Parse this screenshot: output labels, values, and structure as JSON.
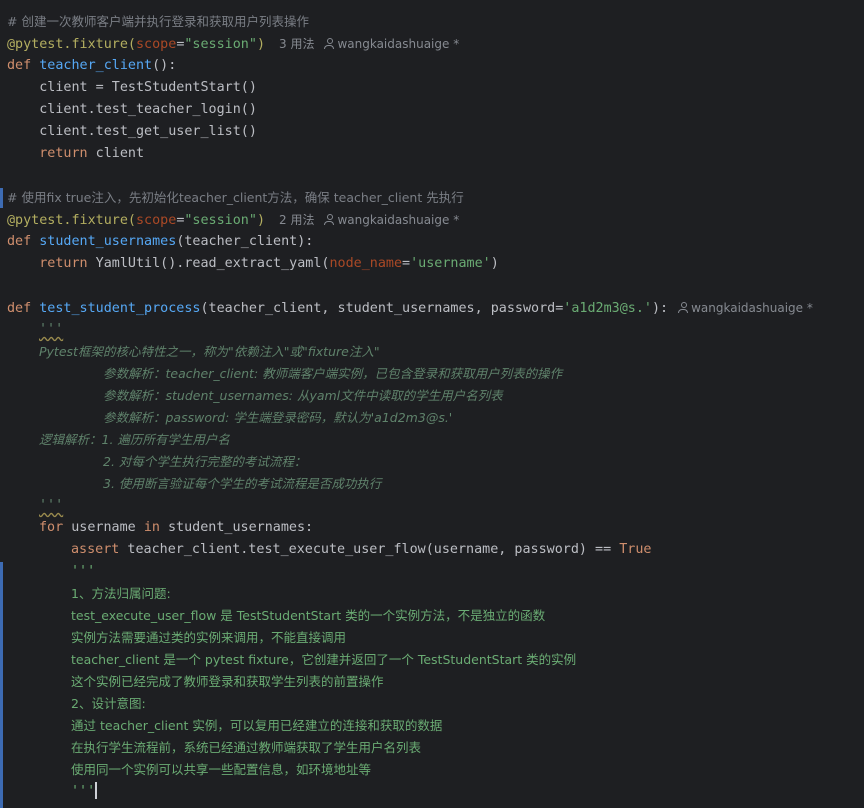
{
  "l1": "# 创建一次教师客户端并执行登录和获取用户列表操作",
  "l2": {
    "deco": "@pytest.fixture(",
    "param": "scope",
    "eq": "=",
    "str": "\"session\"",
    "close": ")",
    "usages": "3 用法",
    "author": "wangkaidashuaige *"
  },
  "l3": {
    "kw": "def ",
    "fn": "teacher_client",
    "rest": "():"
  },
  "l4": "    client = TestStudentStart()",
  "l5": "    client.test_teacher_login()",
  "l6": "    client.test_get_user_list()",
  "l7": {
    "kw": "    return",
    "rest": " client"
  },
  "l9": "# 使用fix true注入，先初始化teacher_client方法，确保 teacher_client 先执行",
  "l10": {
    "deco": "@pytest.fixture(",
    "param": "scope",
    "eq": "=",
    "str": "\"session\"",
    "close": ")",
    "usages": "2 用法",
    "author": "wangkaidashuaige *"
  },
  "l11": {
    "kw": "def ",
    "fn": "student_usernames",
    "rest": "(teacher_client):"
  },
  "l12": {
    "kw": "    return",
    "a": " YamlUtil().read_extract_yaml(",
    "param": "node_name",
    "eq": "=",
    "str": "'username'",
    "close": ")"
  },
  "l14": {
    "kw": "def ",
    "fn": "test_student_process",
    "a": "(teacher_client, student_usernames, password=",
    "str": "'a1d2m3@s.'",
    "close": "):",
    "author": "wangkaidashuaige *"
  },
  "doc": {
    "q1": "'''",
    "d1": "Pytest框架的核心特性之一，称为\"依赖注入\"或\"fixture注入\"",
    "d2": "参数解析：teacher_client: 教师端客户端实例，已包含登录和获取用户列表的操作",
    "d3": "参数解析：student_usernames: 从yaml文件中读取的学生用户名列表",
    "d4": "参数解析：password: 学生端登录密码，默认为'a1d2m3@s.'",
    "d5": "逻辑解析：1. 遍历所有学生用户名",
    "d6": "2. 对每个学生执行完整的考试流程：",
    "d7": "3. 使用断言验证每个学生的考试流程是否成功执行",
    "q2": "'''"
  },
  "l24": {
    "kw": "for",
    "a": " username ",
    "kw2": "in",
    "b": " student_usernames:"
  },
  "l25": {
    "kw": "assert",
    "a": " teacher_client.test_execute_user_flow(username, password) == ",
    "t": "True"
  },
  "note": {
    "q1": "'''",
    "n1": "1、方法归属问题:",
    "n2": "test_execute_user_flow 是 TestStudentStart 类的一个实例方法，不是独立的函数",
    "n3": "实例方法需要通过类的实例来调用，不能直接调用",
    "n4": "teacher_client 是一个 pytest fixture，它创建并返回了一个 TestStudentStart 类的实例",
    "n5": "这个实例已经完成了教师登录和获取学生列表的前置操作",
    "n6": "2、设计意图:",
    "n7": "通过 teacher_client 实例，可以复用已经建立的连接和获取的数据",
    "n8": "在执行学生流程前，系统已经通过教师端获取了学生用户名列表",
    "n9": "使用同一个实例可以共享一些配置信息，如环境地址等",
    "q2": "'''"
  }
}
